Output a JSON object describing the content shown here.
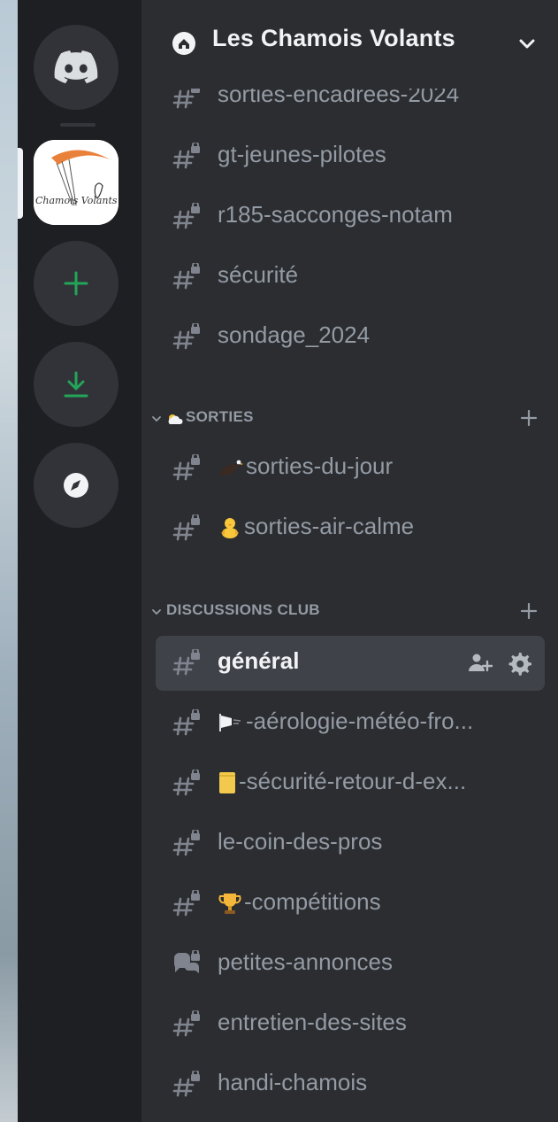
{
  "server": {
    "name": "Les Chamois Volants",
    "icon_text": "Chamois Volants"
  },
  "rail": {
    "items": [
      {
        "name": "Discord home",
        "icon": "discord-icon"
      },
      {
        "name": "Les Chamois Volants",
        "icon": "server-logo"
      },
      {
        "name": "Add a server",
        "icon": "plus-icon"
      },
      {
        "name": "Download apps",
        "icon": "download-icon"
      },
      {
        "name": "Explore",
        "icon": "compass-icon"
      }
    ]
  },
  "channels": {
    "top": [
      {
        "label": "sorties-encadrees-2024",
        "icon": "hash-lock-icon"
      },
      {
        "label": "gt-jeunes-pilotes",
        "icon": "hash-lock-icon"
      },
      {
        "label": "r185-sacconges-notam",
        "icon": "hash-lock-icon"
      },
      {
        "label": "sécurité",
        "icon": "hash-lock-icon"
      },
      {
        "label": "sondage_2024",
        "icon": "hash-lock-icon"
      }
    ],
    "categories": [
      {
        "label": "SORTIES",
        "icon": "cloud-icon",
        "items": [
          {
            "label": "sorties-du-jour",
            "emoji": "eagle-emoji",
            "icon": "hash-lock-icon"
          },
          {
            "label": "sorties-air-calme",
            "emoji": "chick-emoji",
            "icon": "hash-lock-icon"
          }
        ]
      },
      {
        "label": "DISCUSSIONS CLUB",
        "items": [
          {
            "label": "général",
            "icon": "hash-lock-icon",
            "selected": true
          },
          {
            "label": "-aérologie-météo-fro...",
            "emoji": "windsock-emoji",
            "icon": "hash-lock-icon"
          },
          {
            "label": "-sécurité-retour-d-ex...",
            "emoji": "notepad-emoji",
            "icon": "hash-lock-icon"
          },
          {
            "label": "le-coin-des-pros",
            "icon": "hash-lock-icon"
          },
          {
            "label": "-compétitions",
            "emoji": "trophy-emoji",
            "icon": "hash-lock-icon"
          },
          {
            "label": "petites-annonces",
            "icon": "forum-lock-icon"
          },
          {
            "label": "entretien-des-sites",
            "icon": "hash-lock-icon"
          },
          {
            "label": "handi-chamois",
            "icon": "hash-lock-icon"
          }
        ]
      }
    ]
  },
  "colors": {
    "rail_bg": "#1e1f22",
    "list_bg": "#2b2d31",
    "selected_bg": "#404249",
    "muted_text": "#949ba4",
    "bright_text": "#f2f3f5",
    "green": "#23a559"
  }
}
